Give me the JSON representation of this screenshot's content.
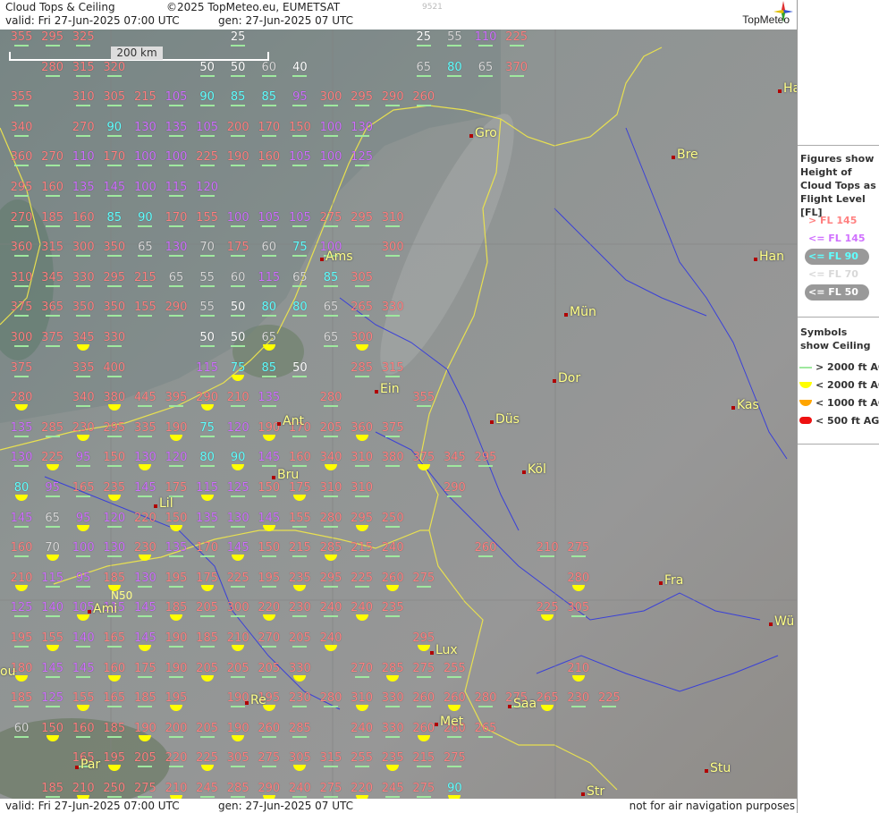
{
  "header": {
    "title": "Cloud Tops & Ceiling",
    "copyright": "©2025 TopMeteo.eu, EUMETSAT",
    "valid": "valid:  Fri  27-Jun-2025  07:00 UTC",
    "gen": "gen: 27-Jun-2025 07 UTC",
    "frame_id": "9521",
    "logo": "TopMeteo"
  },
  "footer": {
    "valid": "valid:  Fri  27-Jun-2025  07:00 UTC",
    "gen": "gen: 27-Jun-2025 07 UTC",
    "disclaimer": "not for air navigation purposes"
  },
  "scale_label": "200 km",
  "lat_label": "N50",
  "legend": {
    "figures_title": "Figures show Height of Cloud Tops as Flight Level  [FL]",
    "fl_items": [
      {
        "text": "> FL 145",
        "color": "#ff8080"
      },
      {
        "text": "<= FL 145",
        "color": "#d070ff"
      },
      {
        "text": "<= FL 90",
        "color": "#60ffff"
      },
      {
        "text": "<= FL 70",
        "color": "#d8d8d8"
      },
      {
        "text": "<= FL 50",
        "color": "#ffffff"
      }
    ],
    "symbols_title": "Symbols show Ceiling",
    "sym_items": [
      {
        "text": "> 2000 ft AGL",
        "color": "#9fe89f"
      },
      {
        "text": "< 2000 ft AGL",
        "color": "#ffff00"
      },
      {
        "text": "< 1000 ft AGL",
        "color": "#ffa500"
      },
      {
        "text": "< 500 ft AGL",
        "color": "#ee1111"
      }
    ]
  },
  "cities": [
    {
      "name": "Gro"
    },
    {
      "name": "Bre"
    },
    {
      "name": "Ams"
    },
    {
      "name": "Han"
    },
    {
      "name": "Mün"
    },
    {
      "name": "Dor"
    },
    {
      "name": "Ein"
    },
    {
      "name": "Ant"
    },
    {
      "name": "Düs"
    },
    {
      "name": "Kas"
    },
    {
      "name": "Köl"
    },
    {
      "name": "Bru"
    },
    {
      "name": "Lil"
    },
    {
      "name": "Fra"
    },
    {
      "name": "Ami"
    },
    {
      "name": "Wü"
    },
    {
      "name": "Lux"
    },
    {
      "name": "Saa"
    },
    {
      "name": "Re"
    },
    {
      "name": "Met"
    },
    {
      "name": "Par"
    },
    {
      "name": "Stu"
    },
    {
      "name": "Ha"
    },
    {
      "name": "ou"
    },
    {
      "name": "Str"
    }
  ],
  "rows": [
    [
      "355",
      "295",
      "325",
      "",
      "",
      "",
      "",
      "25",
      "",
      "",
      "",
      "",
      "",
      "25",
      "55",
      "110",
      "225",
      "",
      "",
      "",
      "",
      "",
      "",
      "",
      "",
      ""
    ],
    [
      "",
      "280",
      "315",
      "320",
      "",
      "",
      "50",
      "50",
      "60",
      "40",
      "",
      "",
      "",
      "65",
      "80",
      "65",
      "370",
      "",
      "",
      "",
      "",
      "",
      "",
      "",
      "",
      ""
    ],
    [
      "355",
      "",
      "310",
      "305",
      "215",
      "105",
      "90",
      "85",
      "85",
      "95",
      "300",
      "295",
      "290",
      "260",
      "",
      "",
      "",
      "",
      "",
      "",
      "",
      "",
      "",
      "",
      "",
      ""
    ],
    [
      "340",
      "",
      "270",
      "90",
      "130",
      "135",
      "105",
      "200",
      "170",
      "150",
      "100",
      "130",
      "",
      "",
      "",
      "",
      "",
      "",
      "",
      "",
      "",
      "",
      "",
      "",
      "",
      ""
    ],
    [
      "360",
      "270",
      "110",
      "170",
      "100",
      "100",
      "225",
      "190",
      "160",
      "105",
      "100",
      "125",
      "",
      "",
      "",
      "",
      "",
      "",
      "",
      "",
      "",
      "",
      "",
      "",
      "",
      ""
    ],
    [
      "295",
      "160",
      "135",
      "145",
      "100",
      "115",
      "120",
      "",
      "",
      "",
      "",
      "",
      "",
      "",
      "",
      "",
      "",
      "",
      "",
      "",
      "",
      "",
      "",
      "",
      "",
      ""
    ],
    [
      "270",
      "185",
      "160",
      "85",
      "90",
      "170",
      "155",
      "100",
      "105",
      "105",
      "275",
      "295",
      "310",
      "",
      "",
      "",
      "",
      "",
      "",
      "",
      "",
      "",
      "",
      "",
      "",
      ""
    ],
    [
      "360",
      "315",
      "300",
      "350",
      "65",
      "130",
      "70",
      "175",
      "60",
      "75",
      "100",
      "",
      "300",
      "",
      "",
      "",
      "",
      "",
      "",
      "",
      "",
      "",
      "",
      "",
      "",
      ""
    ],
    [
      "310",
      "345",
      "330",
      "295",
      "215",
      "65",
      "55",
      "60",
      "115",
      "65",
      "85",
      "305",
      "",
      "",
      "",
      "",
      "",
      "",
      "",
      "",
      "",
      "",
      "",
      "",
      "",
      ""
    ],
    [
      "375",
      "365",
      "350",
      "350",
      "155",
      "290",
      "55",
      "50",
      "80",
      "80",
      "65",
      "265",
      "330",
      "",
      "",
      "",
      "",
      "",
      "",
      "",
      "",
      "",
      "",
      "",
      "",
      ""
    ],
    [
      "300",
      "375",
      "345",
      "330",
      "",
      "",
      "50",
      "50",
      "65",
      "",
      "65",
      "300",
      "",
      "",
      "",
      "",
      "",
      "",
      "",
      "",
      "",
      "",
      "",
      "",
      "",
      ""
    ],
    [
      "375",
      "",
      "335",
      "400",
      "",
      "",
      "115",
      "75",
      "85",
      "50",
      "",
      "285",
      "315",
      "",
      "",
      "",
      "",
      "",
      "",
      "",
      "",
      "",
      "",
      "",
      "",
      ""
    ],
    [
      "280",
      "",
      "340",
      "380",
      "445",
      "395",
      "290",
      "210",
      "135",
      "",
      "280",
      "",
      "",
      "355",
      "",
      "",
      "",
      "",
      "",
      "",
      "",
      "",
      "",
      "",
      "",
      ""
    ],
    [
      "135",
      "285",
      "230",
      "295",
      "335",
      "190",
      "75",
      "120",
      "190",
      "170",
      "205",
      "360",
      "375",
      "",
      "",
      "",
      "",
      "",
      "",
      "",
      "",
      "",
      "",
      "",
      "",
      ""
    ],
    [
      "130",
      "225",
      "95",
      "150",
      "130",
      "120",
      "80",
      "90",
      "145",
      "160",
      "340",
      "310",
      "380",
      "375",
      "345",
      "295",
      "",
      "",
      "",
      "",
      "",
      "",
      "",
      "",
      "",
      ""
    ],
    [
      "80",
      "95",
      "165",
      "235",
      "145",
      "175",
      "115",
      "125",
      "150",
      "175",
      "310",
      "310",
      "",
      "",
      "290",
      "",
      "",
      "",
      "",
      "",
      "",
      "",
      "",
      "",
      "",
      ""
    ],
    [
      "145",
      "65",
      "95",
      "120",
      "220",
      "150",
      "135",
      "130",
      "145",
      "155",
      "280",
      "295",
      "250",
      "",
      "",
      "",
      "",
      "",
      "",
      "",
      "",
      "",
      "",
      "",
      "",
      ""
    ],
    [
      "160",
      "70",
      "100",
      "130",
      "230",
      "135",
      "170",
      "145",
      "150",
      "215",
      "285",
      "215",
      "240",
      "",
      "",
      "260",
      "",
      "210",
      "275",
      "",
      "",
      "",
      "",
      "",
      "",
      ""
    ],
    [
      "210",
      "115",
      "95",
      "185",
      "130",
      "195",
      "175",
      "225",
      "195",
      "235",
      "295",
      "225",
      "260",
      "275",
      "",
      "",
      "",
      "",
      "280",
      "",
      "",
      "",
      "",
      "",
      "",
      ""
    ],
    [
      "125",
      "140",
      "105",
      "115",
      "145",
      "185",
      "205",
      "300",
      "220",
      "230",
      "240",
      "240",
      "235",
      "",
      "",
      "",
      "",
      "225",
      "305",
      "",
      "",
      "",
      "",
      "",
      "",
      ""
    ],
    [
      "195",
      "155",
      "140",
      "165",
      "145",
      "190",
      "185",
      "210",
      "270",
      "205",
      "240",
      "",
      "",
      "295",
      "",
      "",
      "",
      "",
      "",
      "",
      "",
      "",
      "",
      "",
      "",
      ""
    ],
    [
      "180",
      "145",
      "145",
      "160",
      "175",
      "190",
      "205",
      "205",
      "205",
      "330",
      "",
      "270",
      "285",
      "275",
      "255",
      "",
      "",
      "",
      "210",
      "",
      "",
      "",
      "",
      "",
      "",
      ""
    ],
    [
      "185",
      "125",
      "155",
      "165",
      "185",
      "195",
      "",
      "190",
      "195",
      "230",
      "280",
      "310",
      "330",
      "260",
      "260",
      "280",
      "275",
      "265",
      "230",
      "225",
      "",
      "",
      "",
      "",
      "",
      ""
    ],
    [
      "60",
      "150",
      "160",
      "185",
      "190",
      "200",
      "205",
      "190",
      "260",
      "285",
      "",
      "240",
      "330",
      "260",
      "260",
      "265",
      "",
      "",
      "",
      "",
      "",
      "",
      "",
      "",
      "",
      ""
    ],
    [
      "",
      "",
      "165",
      "195",
      "205",
      "220",
      "225",
      "305",
      "275",
      "305",
      "315",
      "255",
      "235",
      "215",
      "275",
      "",
      "",
      "",
      "",
      "",
      "",
      "",
      "",
      "",
      "",
      ""
    ],
    [
      "",
      "185",
      "210",
      "250",
      "275",
      "210",
      "245",
      "285",
      "290",
      "240",
      "275",
      "220",
      "245",
      "275",
      "90",
      "",
      "",
      "",
      "",
      "",
      "",
      "",
      "",
      "",
      "",
      ""
    ]
  ]
}
